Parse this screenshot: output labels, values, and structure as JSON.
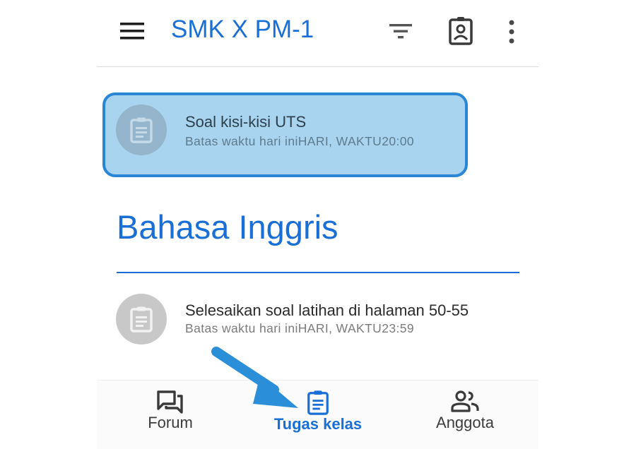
{
  "app": {
    "title": "SMK X PM-1",
    "accent_color": "#1a6fd6"
  },
  "header": {
    "icons": [
      "menu-icon",
      "filter-icon",
      "assignment-icon",
      "more-vert-icon"
    ]
  },
  "highlighted_item": {
    "title": "Soal kisi-kisi UTS",
    "subtitle": "Batas waktu hari iniHARI, WAKTU20:00",
    "icon": "assignment-icon",
    "highlight_color": "#a8d4ef",
    "highlight_border": "#2a86d4"
  },
  "section": {
    "title": "Bahasa Inggris",
    "items": [
      {
        "title": "Selesaikan soal latihan di halaman 50-55",
        "subtitle": "Batas waktu hari iniHARI, WAKTU23:59",
        "icon": "assignment-icon"
      }
    ]
  },
  "bottom_nav": {
    "items": [
      {
        "label": "Forum",
        "icon": "forum-icon",
        "active": false
      },
      {
        "label": "Tugas kelas",
        "icon": "assignment-icon",
        "active": true
      },
      {
        "label": "Anggota",
        "icon": "people-icon",
        "active": false
      }
    ]
  },
  "annotation": {
    "icon": "pointer-arrow-icon",
    "color": "#2a8fd8"
  }
}
